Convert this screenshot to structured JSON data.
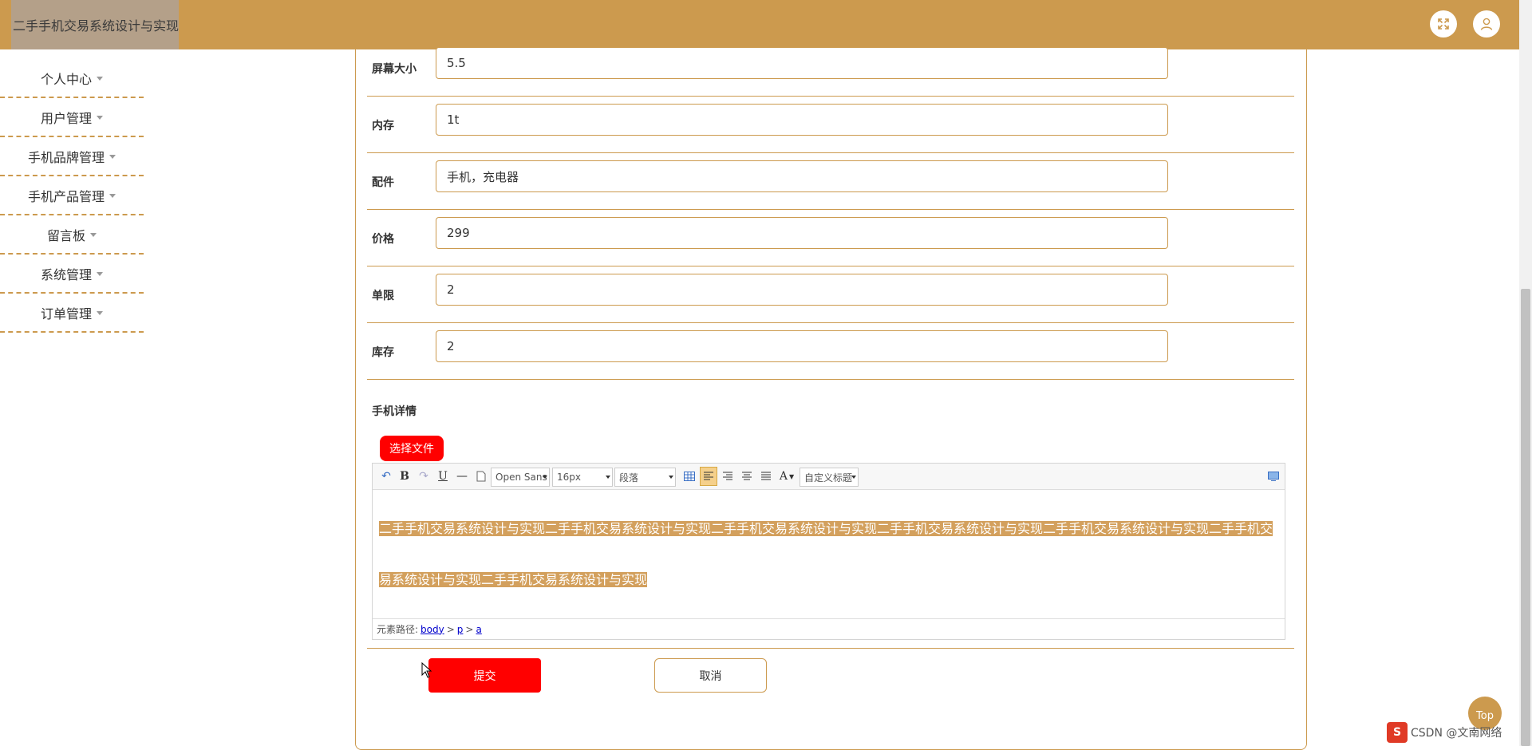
{
  "header": {
    "title": "二手手机交易系统设计与实现",
    "fullscreen_icon": "expand-icon",
    "user_icon": "user-icon"
  },
  "sidebar": {
    "items": [
      {
        "label": "个人中心"
      },
      {
        "label": "用户管理"
      },
      {
        "label": "手机品牌管理"
      },
      {
        "label": "手机产品管理"
      },
      {
        "label": "留言板"
      },
      {
        "label": "系统管理"
      },
      {
        "label": "订单管理"
      }
    ]
  },
  "form": {
    "fields": [
      {
        "label": "屏幕大小",
        "value": "5.5"
      },
      {
        "label": "内存",
        "value": "1t"
      },
      {
        "label": "配件",
        "value": "手机，充电器"
      },
      {
        "label": "价格",
        "value": "299"
      },
      {
        "label": "单限",
        "value": "2"
      },
      {
        "label": "库存",
        "value": "2"
      }
    ],
    "detail_label": "手机详情",
    "choose_file_label": "选择文件",
    "submit_label": "提交",
    "cancel_label": "取消"
  },
  "editor": {
    "font_family": "Open Sans",
    "font_size": "16px",
    "paragraph": "段落",
    "custom_title": "自定义标题",
    "content_line1": "二手手机交易系统设计与实现二手手机交易系统设计与实现二手手机交易系统设计与实现二手手机交易系统设计与实现二手手机交易系统设计与实现二手手机交",
    "content_line2": "易系统设计与实现二手手机交易系统设计与实现",
    "path_label": "元素路径:",
    "path_body": "body",
    "path_sep1": ">",
    "path_p": "p",
    "path_sep2": ">",
    "path_a": "a"
  },
  "top_button": "Top",
  "watermark": {
    "badge": "S",
    "text": "CSDN @文南网络"
  },
  "colors": {
    "accent": "#cc9a4e",
    "primary_button": "#ff0000",
    "highlight": "#d3a05d"
  }
}
